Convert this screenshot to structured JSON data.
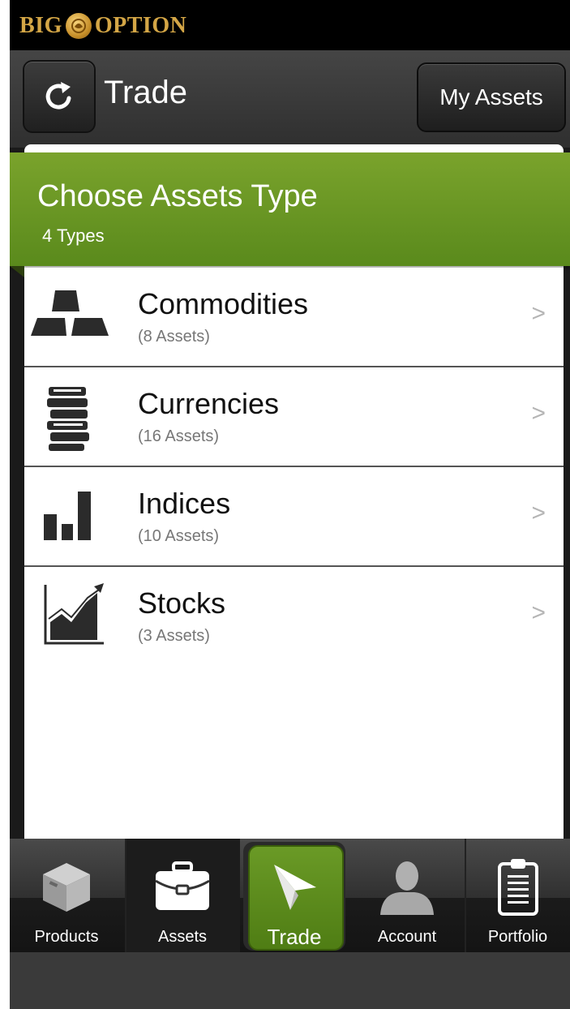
{
  "brand": {
    "name_left": "BIG",
    "name_right": "OPTION",
    "logo_icon": "lion-coin-icon"
  },
  "navbar": {
    "title": "Trade",
    "refresh_icon": "refresh-icon",
    "my_assets_label": "My Assets"
  },
  "header": {
    "title": "Choose Assets Type",
    "subtitle": "4 Types",
    "color": "#6a9a26"
  },
  "assets": [
    {
      "title": "Commodities",
      "count": "(8 Assets)",
      "icon": "gold-bars-icon",
      "chevron": ">"
    },
    {
      "title": "Currencies",
      "count": "(16 Assets)",
      "icon": "coin-stack-icon",
      "chevron": ">"
    },
    {
      "title": "Indices",
      "count": "(10 Assets)",
      "icon": "bar-chart-icon",
      "chevron": ">"
    },
    {
      "title": "Stocks",
      "count": "(3 Assets)",
      "icon": "stock-chart-icon",
      "chevron": ">"
    }
  ],
  "tabs": [
    {
      "label": "Products",
      "icon": "box-icon"
    },
    {
      "label": "Assets",
      "icon": "briefcase-icon"
    },
    {
      "label": "Trade",
      "icon": "paper-plane-icon",
      "active": true
    },
    {
      "label": "Account",
      "icon": "person-icon"
    },
    {
      "label": "Portfolio",
      "icon": "clipboard-icon"
    }
  ],
  "colors": {
    "accent_green": "#6a9a26",
    "brand_gold": "#d4a646"
  }
}
